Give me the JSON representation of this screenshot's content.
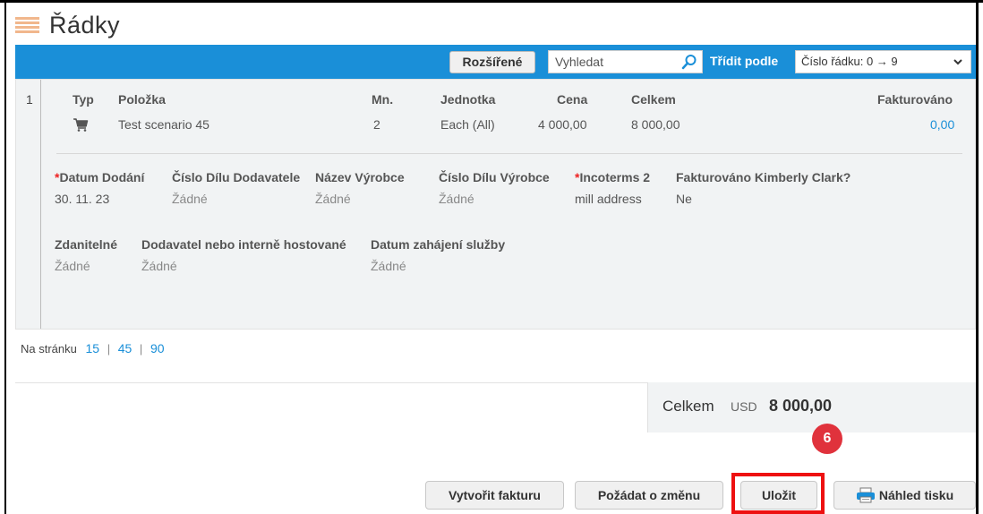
{
  "section": {
    "title": "Řádky"
  },
  "toolbar": {
    "advanced_label": "Rozšířené",
    "search_placeholder": "Vyhledat",
    "sort_label": "Třídit podle",
    "sort_value": "Číslo řádku: 0 → 9"
  },
  "line": {
    "number": "1",
    "headers": {
      "type": "Typ",
      "item": "Položka",
      "qty": "Mn.",
      "unit": "Jednotka",
      "price": "Cena",
      "total": "Celkem",
      "invoiced": "Fakturováno"
    },
    "values": {
      "item": "Test scenario 45",
      "qty": "2",
      "unit": "Each (All)",
      "price": "4 000,00",
      "total": "8 000,00",
      "invoiced": "0,00"
    },
    "details_row1": {
      "delivery_date_label": "Datum Dodání",
      "delivery_date_value": "30. 11. 23",
      "supplier_part_label": "Číslo Dílu Dodavatele",
      "supplier_part_value": "Žádné",
      "manufacturer_name_label": "Název Výrobce",
      "manufacturer_name_value": "Žádné",
      "manufacturer_part_label": "Číslo Dílu Výrobce",
      "manufacturer_part_value": "Žádné",
      "incoterms_label": "Incoterms 2",
      "incoterms_value": "mill address",
      "invoiced_kc_label": "Fakturováno Kimberly Clark?",
      "invoiced_kc_value": "Ne"
    },
    "details_row2": {
      "taxable_label": "Zdanitelné",
      "taxable_value": "Žádné",
      "hosted_label": "Dodavatel nebo interně hostované",
      "hosted_value": "Žádné",
      "service_start_label": "Datum zahájení služby",
      "service_start_value": "Žádné"
    },
    "required_marker": "*"
  },
  "paging": {
    "label": "Na stránku",
    "options": [
      "15",
      "45",
      "90"
    ],
    "separator": "|"
  },
  "summary": {
    "total_label": "Celkem",
    "currency": "USD",
    "amount": "8 000,00"
  },
  "step_badge": "6",
  "actions": {
    "create_invoice": "Vytvořit fakturu",
    "request_change": "Požádat o změnu",
    "save": "Uložit",
    "print_preview": "Náhled tisku"
  },
  "colors": {
    "toolbar_blue": "#1a8fd8",
    "link_blue": "#1a8fd8",
    "highlight_red": "#e11111",
    "badge_red": "#e0323c",
    "section_icon": "#f1b78c"
  }
}
